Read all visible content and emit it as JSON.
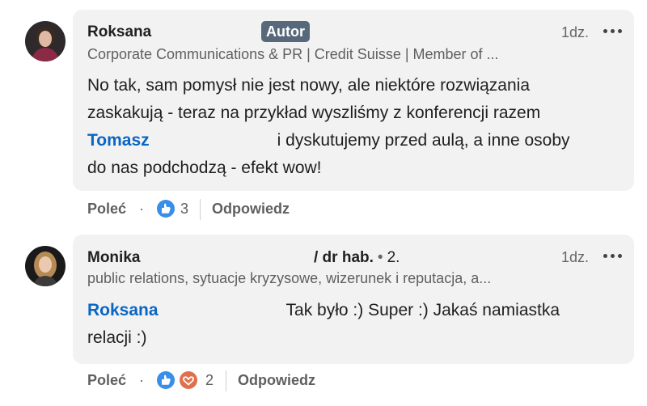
{
  "comments": [
    {
      "author": "Roksana",
      "badge": "Autor",
      "time": "1dz.",
      "headline": "Corporate Communications & PR | Credit Suisse | Member of ...",
      "text_line1": "No tak, sam pomysł nie jest nowy, ale niektóre rozwiązania",
      "text_line2": "zaskakują - teraz na przykład wyszliśmy z konferencji razem",
      "mention": "Tomasz",
      "text_line3_rest": "i dyskutujemy przed aulą, a inne osoby",
      "text_line4": "do nas podchodzą - efekt wow!",
      "like_label": "Poleć",
      "dot": "·",
      "reaction_count": "3",
      "reply_label": "Odpowiedz",
      "reactions": [
        "like-icon"
      ]
    },
    {
      "author": "Monika",
      "title": "/ dr hab.",
      "dot": "•",
      "degree": "2.",
      "time": "1dz.",
      "headline": "public relations, sytuacje kryzysowe, wizerunek i reputacja, a...",
      "mention": "Roksana",
      "text_line1_rest": "Tak było :) Super :) Jakaś namiastka",
      "text_line2": "relacji :)",
      "like_label": "Poleć",
      "action_dot": "·",
      "reaction_count": "2",
      "reply_label": "Odpowiedz",
      "reactions": [
        "like-icon",
        "love-icon"
      ]
    }
  ],
  "colors": {
    "bubble": "#f2f2f2",
    "mention": "#0a66c2",
    "badge": "#56687a",
    "like": "#378fe9",
    "love": "#df704d"
  }
}
